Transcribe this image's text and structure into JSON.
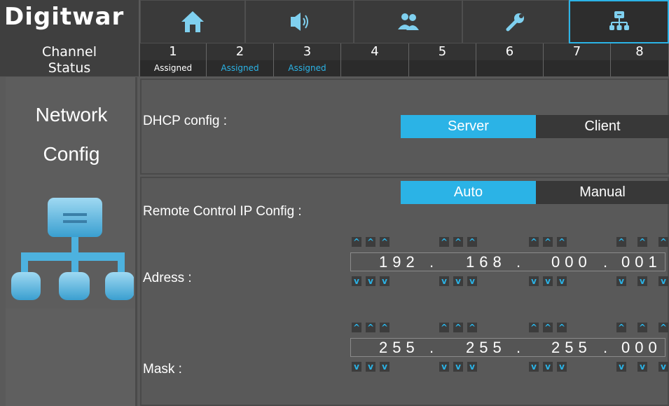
{
  "logo": {
    "text": "Digitwar"
  },
  "tabs": [
    {
      "icon": "home-icon",
      "active": false
    },
    {
      "icon": "speaker-icon",
      "active": false
    },
    {
      "icon": "users-icon",
      "active": false
    },
    {
      "icon": "wrench-icon",
      "active": false
    },
    {
      "icon": "network-icon",
      "active": true
    }
  ],
  "rows": {
    "channel_label": "Channel",
    "status_label": "Status"
  },
  "channels": [
    "1",
    "2",
    "3",
    "4",
    "5",
    "6",
    "7",
    "8"
  ],
  "statuses": [
    "Assigned",
    "Assigned",
    "Assigned",
    "",
    "",
    "",
    "",
    ""
  ],
  "page": {
    "title_line1": "Network",
    "title_line2": "Config",
    "icon": "network-icon"
  },
  "dhcp": {
    "label": "DHCP config :",
    "options": [
      "Server",
      "Client"
    ],
    "selected": "Server"
  },
  "remote": {
    "label": "Remote Control IP Config :",
    "options": [
      "Auto",
      "Manual"
    ],
    "selected": "Auto"
  },
  "address": {
    "label": "Adress :",
    "octets": [
      "192",
      "168",
      "000",
      "001"
    ]
  },
  "mask": {
    "label": "Mask :",
    "octets": [
      "255",
      "255",
      "255",
      "000"
    ]
  },
  "arrows": {
    "up": "^",
    "down": "v"
  },
  "colors": {
    "accent": "#2bb3e6",
    "background": "#5a5a5a",
    "dark": "#383838"
  }
}
